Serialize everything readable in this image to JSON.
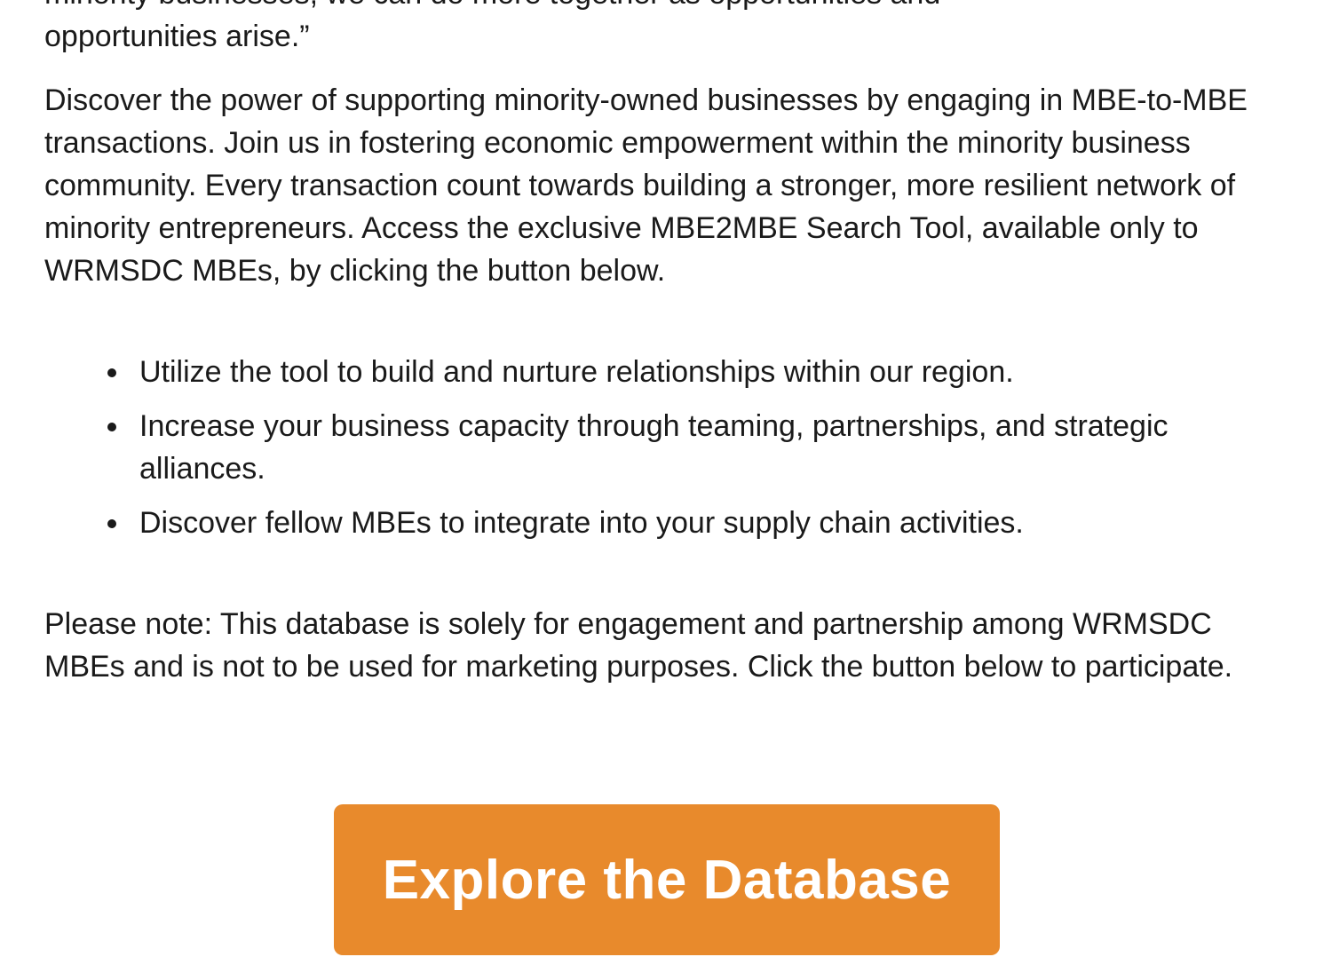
{
  "quote": {
    "partial_line": "minority businesses, we can do more together as opportunities and",
    "last_line": "opportunities arise.”"
  },
  "intro_paragraph": "Discover the power of supporting minority-owned businesses by engaging in MBE-to-MBE transactions. Join us in fostering economic empowerment within the minority business community. Every transaction count towards building a stronger, more resilient network of minority entrepreneurs. Access the exclusive MBE2MBE Search Tool, available only to WRMSDC MBEs, by clicking the button below.",
  "benefits": [
    "Utilize the tool to build and nurture relationships within our region.",
    "Increase your business capacity through teaming, partnerships, and strategic alliances.",
    "Discover fellow MBEs to integrate into your supply chain activities."
  ],
  "note_paragraph": "Please note: This database is solely for engagement and partnership among WRMSDC MBEs and is not to be used for marketing purposes.  Click the button below to participate.",
  "cta": {
    "label": "Explore the Database",
    "color": "#e88a2c",
    "text_color": "#ffffff"
  }
}
